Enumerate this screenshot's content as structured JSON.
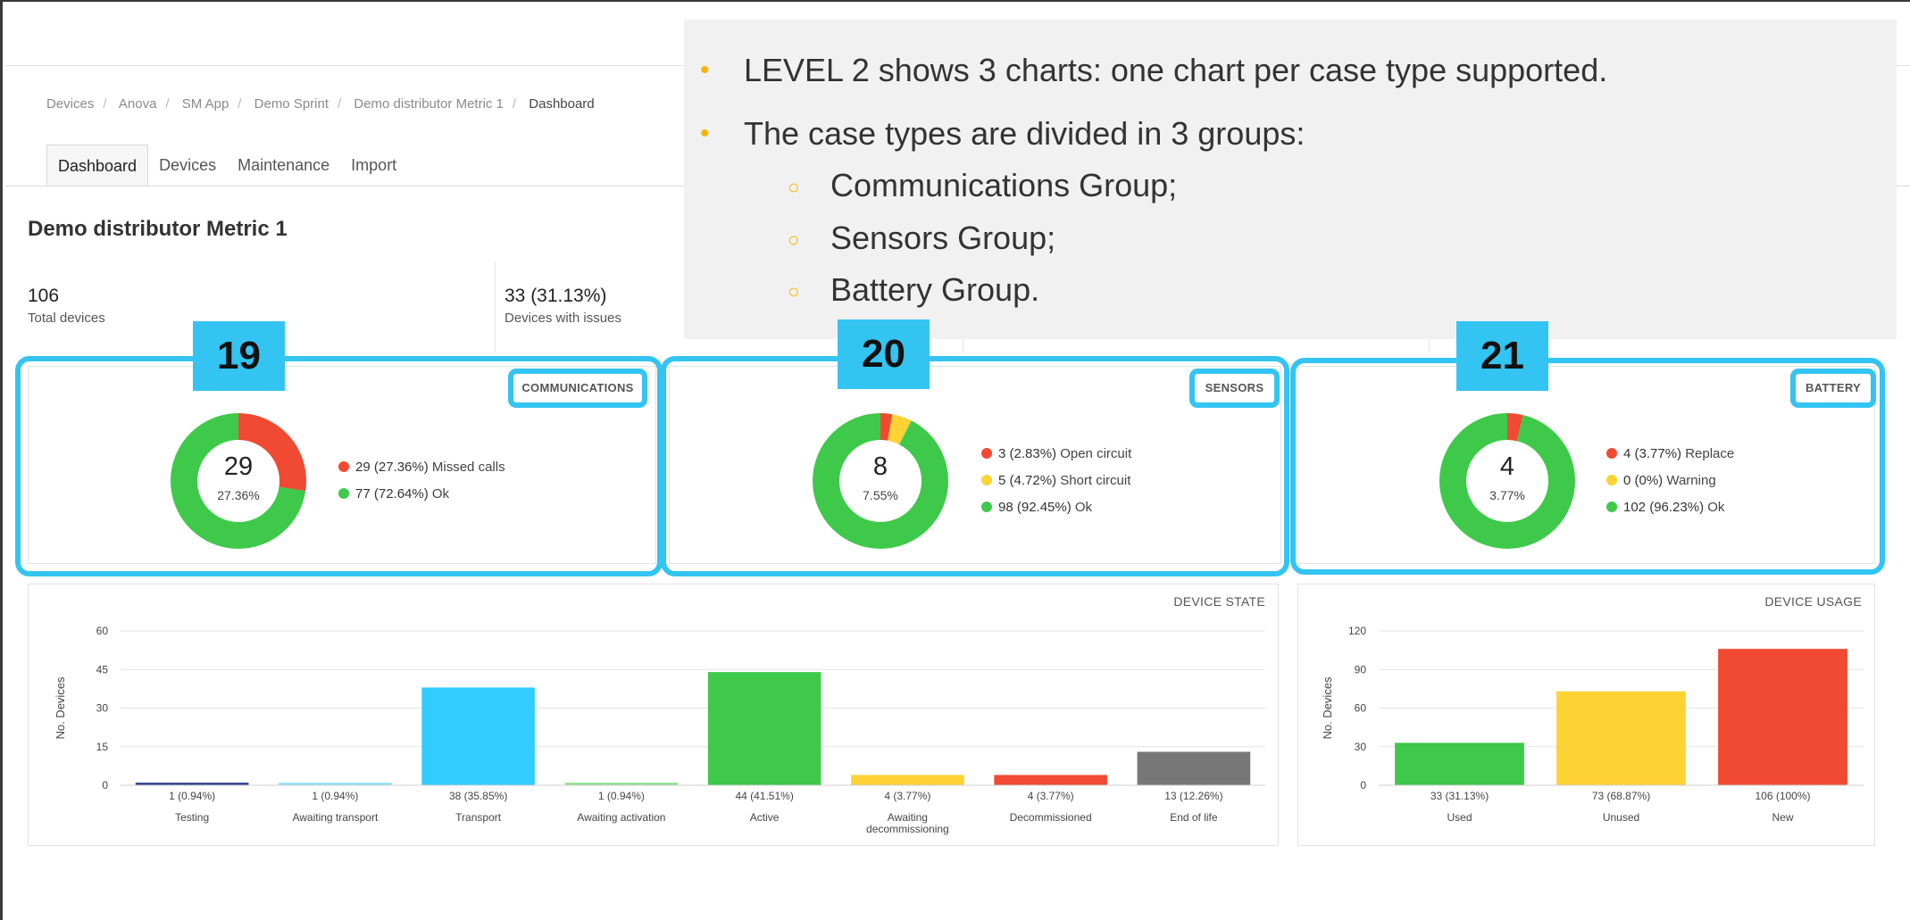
{
  "breadcrumb": [
    "Devices",
    "Anova",
    "SM App",
    "Demo Sprint",
    "Demo distributor Metric 1",
    "Dashboard"
  ],
  "tabs": [
    "Dashboard",
    "Devices",
    "Maintenance",
    "Import"
  ],
  "page_title": "Demo distributor Metric 1",
  "kpis": [
    {
      "value": "106",
      "label": "Total devices"
    },
    {
      "value": "33 (31.13%)",
      "label": "Devices with issues"
    }
  ],
  "note": {
    "bullet1": "LEVEL 2 shows 3 charts: one chart per case type supported.",
    "bullet2": "The case types are divided in 3 groups:",
    "subs": [
      "Communications Group;",
      "Sensors Group;",
      "Battery Group."
    ]
  },
  "badges": [
    "19",
    "20",
    "21"
  ],
  "colors": {
    "red": "#f04a33",
    "yellow": "#fdd235",
    "green": "#3fc94a",
    "blue": "#33ccff",
    "accent": "#33c4f1",
    "gray": "#777777"
  },
  "donuts": [
    {
      "title": "COMMUNICATIONS",
      "center_value": "29",
      "center_pct": "27.36%",
      "legend": [
        {
          "value": "29 (27.36%)",
          "label": "Missed calls",
          "color": "#f04a33",
          "fraction": 0.2736
        },
        {
          "value": "77 (72.64%)",
          "label": "Ok",
          "color": "#3fc94a",
          "fraction": 0.7264
        }
      ]
    },
    {
      "title": "SENSORS",
      "center_value": "8",
      "center_pct": "7.55%",
      "legend": [
        {
          "value": "3 (2.83%)",
          "label": "Open circuit",
          "color": "#f04a33",
          "fraction": 0.0283
        },
        {
          "value": "5 (4.72%)",
          "label": "Short circuit",
          "color": "#fdd235",
          "fraction": 0.0472
        },
        {
          "value": "98 (92.45%)",
          "label": "Ok",
          "color": "#3fc94a",
          "fraction": 0.9245
        }
      ]
    },
    {
      "title": "BATTERY",
      "center_value": "4",
      "center_pct": "3.77%",
      "legend": [
        {
          "value": "4 (3.77%)",
          "label": "Replace",
          "color": "#f04a33",
          "fraction": 0.0377
        },
        {
          "value": "0 (0%)",
          "label": "Warning",
          "color": "#fdd235",
          "fraction": 0
        },
        {
          "value": "102 (96.23%)",
          "label": "Ok",
          "color": "#3fc94a",
          "fraction": 0.9623
        }
      ]
    }
  ],
  "chart_data": [
    {
      "type": "bar",
      "title": "DEVICE STATE",
      "ylabel": "No. Devices",
      "ylim": [
        0,
        60
      ],
      "yticks": [
        0,
        15,
        30,
        45,
        60
      ],
      "categories": [
        "Testing",
        "Awaiting transport",
        "Transport",
        "Awaiting activation",
        "Active",
        "Awaiting decommissioning",
        "Decommissioned",
        "End of life"
      ],
      "values": [
        1,
        1,
        38,
        1,
        44,
        4,
        4,
        13
      ],
      "data_labels": [
        "1 (0.94%)",
        "1 (0.94%)",
        "38 (35.85%)",
        "1 (0.94%)",
        "44 (41.51%)",
        "4 (3.77%)",
        "4 (3.77%)",
        "13 (12.26%)"
      ],
      "colors": [
        "#2e3f8f",
        "#8fe3f6",
        "#33ccff",
        "#8fe28f",
        "#3fc94a",
        "#fdd235",
        "#f04a33",
        "#777777"
      ],
      "grid": true
    },
    {
      "type": "bar",
      "title": "DEVICE USAGE",
      "ylabel": "No. Devices",
      "ylim": [
        0,
        120
      ],
      "yticks": [
        0,
        30,
        60,
        90,
        120
      ],
      "categories": [
        "Used",
        "Unused",
        "New"
      ],
      "values": [
        33,
        73,
        106
      ],
      "data_labels": [
        "33 (31.13%)",
        "73 (68.87%)",
        "106 (100%)"
      ],
      "colors": [
        "#3fc94a",
        "#fdd235",
        "#f04a33"
      ],
      "grid": true
    }
  ]
}
